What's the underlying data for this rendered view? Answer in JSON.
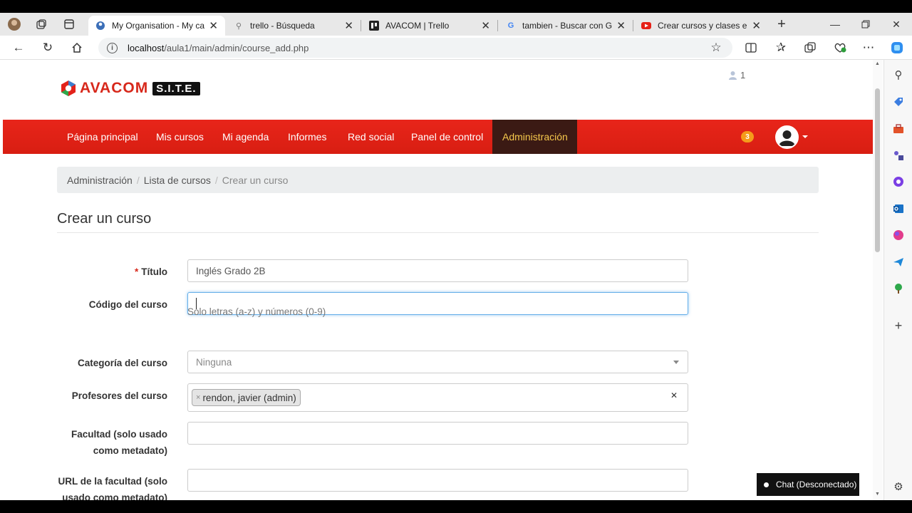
{
  "browser": {
    "tabs": [
      {
        "title": "My Organisation - My cam",
        "active": true
      },
      {
        "title": "trello - Búsqueda",
        "active": false
      },
      {
        "title": "AVACOM | Trello",
        "active": false
      },
      {
        "title": "tambien - Buscar con Goo",
        "active": false
      },
      {
        "title": "Crear cursos y clases en C",
        "active": false
      }
    ],
    "url_host": "localhost",
    "url_path": "/aula1/main/admin/course_add.php"
  },
  "header": {
    "brand": "AVACOM",
    "brand_suffix": "S.I.T.E.",
    "online_users": "1",
    "notifications": "3"
  },
  "nav": {
    "items": [
      {
        "label": "Página principal"
      },
      {
        "label": "Mis cursos"
      },
      {
        "label": "Mi agenda"
      },
      {
        "label": "Informes"
      },
      {
        "label": "Red social"
      },
      {
        "label": "Panel de control"
      },
      {
        "label": "Administración",
        "active": true
      }
    ]
  },
  "breadcrumb": {
    "items": [
      "Administración",
      "Lista de cursos",
      "Crear un curso"
    ]
  },
  "form": {
    "heading": "Crear un curso",
    "title_label": "Título",
    "title_value": "Inglés Grado  2B",
    "code_label": "Código del curso",
    "code_value": "",
    "code_help": "Solo letras (a-z) y números (0-9)",
    "category_label": "Categoría del curso",
    "category_value": "Ninguna",
    "teachers_label": "Profesores del curso",
    "teacher_chip": "rendon, javier (admin)",
    "faculty_label_1": "Facultad (solo usado",
    "faculty_label_2": "como metadato)",
    "faculty_url_label_1": "URL de la facultad (solo",
    "faculty_url_label_2": "usado como metadato)"
  },
  "chat": {
    "label": "Chat (Desconectado)"
  },
  "colors": {
    "navbar": "#e3221a",
    "active_nav": "#3b1a14",
    "active_nav_text": "#f5c84c",
    "badge": "#f59b1b"
  }
}
